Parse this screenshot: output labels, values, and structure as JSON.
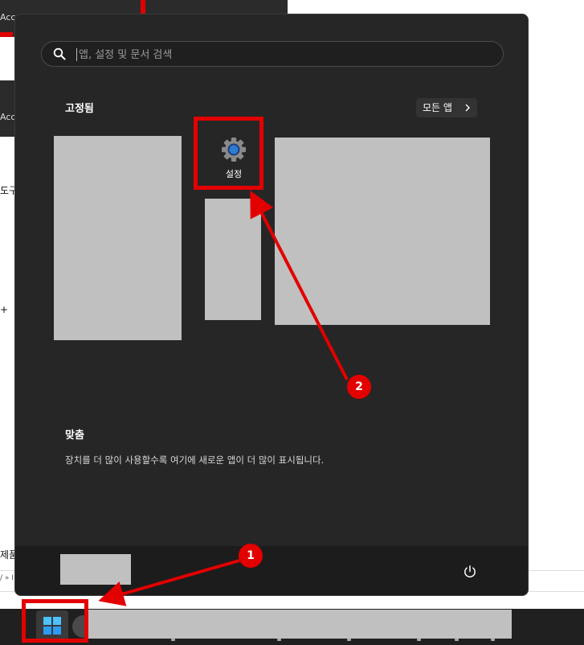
{
  "background": {
    "snippets": [
      {
        "id": "acc1",
        "text": "Acce"
      },
      {
        "id": "acc2",
        "text": "Acce"
      },
      {
        "id": "tool",
        "text": "도구"
      },
      {
        "id": "plus",
        "text": "+"
      },
      {
        "id": "frag",
        "text": "제품"
      },
      {
        "id": "path",
        "text": "/ » I"
      }
    ]
  },
  "start_menu": {
    "search": {
      "placeholder": "앱, 설정 및 문서 검색"
    },
    "pinned": {
      "title": "고정됨",
      "all_apps_label": "모든 앱",
      "apps": [
        {
          "label": "설정",
          "icon": "gear-icon"
        }
      ]
    },
    "recommended": {
      "title": "맞춤",
      "description": "장치를 더 많이 사용할수록 여기에 새로운 앱이 더 많이 표시됩니다."
    },
    "footer": {
      "power_icon": "power-icon"
    }
  },
  "taskbar": {
    "start_icon": "windows-logo-icon"
  },
  "annotations": {
    "badge_1": "1",
    "badge_2": "2",
    "color": "#e30000"
  }
}
